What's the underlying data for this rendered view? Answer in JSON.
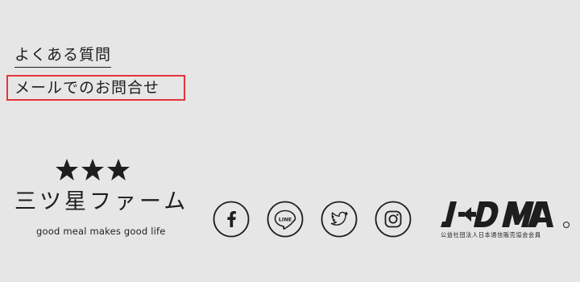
{
  "links": {
    "faq": "よくある質問",
    "contact": "メールでのお問合せ"
  },
  "brand": {
    "name": "三ツ星ファーム",
    "tagline": "good meal makes good life",
    "logo_icon": "three-stars-icon"
  },
  "social": [
    {
      "name": "facebook",
      "icon": "facebook-icon"
    },
    {
      "name": "line",
      "icon": "line-icon",
      "text": "LINE"
    },
    {
      "name": "twitter",
      "icon": "twitter-icon"
    },
    {
      "name": "instagram",
      "icon": "instagram-icon"
    }
  ],
  "jadma": {
    "logo_text": "JADMA",
    "org_name": "公益社団法人日本通信販売協会会員"
  },
  "colors": {
    "background": "#e6e6e6",
    "text": "#1e1e1e",
    "highlight_border": "#e4343c"
  }
}
